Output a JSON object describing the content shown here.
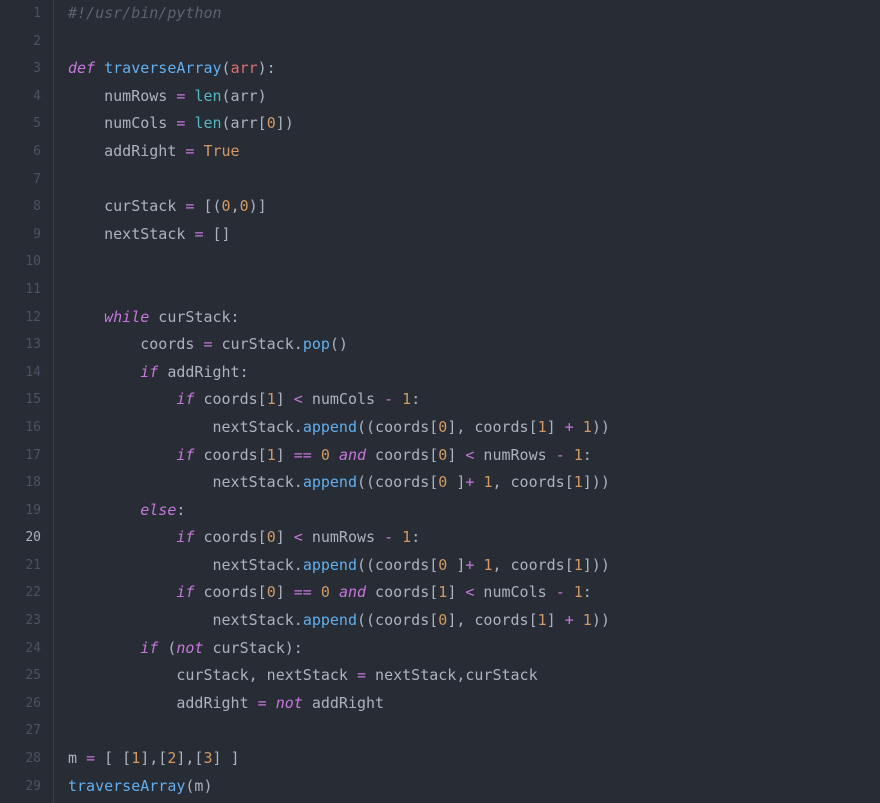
{
  "editor": {
    "active_line": 20,
    "line_numbers": [
      "1",
      "2",
      "3",
      "4",
      "5",
      "6",
      "7",
      "8",
      "9",
      "10",
      "11",
      "12",
      "13",
      "14",
      "15",
      "16",
      "17",
      "18",
      "19",
      "20",
      "21",
      "22",
      "23",
      "24",
      "25",
      "26",
      "27",
      "28",
      "29"
    ],
    "tokens": [
      [
        {
          "t": "#!/usr/bin/python",
          "c": "c-comment"
        }
      ],
      [],
      [
        {
          "t": "def ",
          "c": "c-keyword"
        },
        {
          "t": "traverseArray",
          "c": "c-def"
        },
        {
          "t": "(",
          "c": "c-punct"
        },
        {
          "t": "arr",
          "c": "c-var"
        },
        {
          "t": "):",
          "c": "c-punct"
        }
      ],
      [
        {
          "t": "    numRows ",
          "c": "c-punct"
        },
        {
          "t": "=",
          "c": "c-op"
        },
        {
          "t": " ",
          "c": ""
        },
        {
          "t": "len",
          "c": "c-builtin"
        },
        {
          "t": "(arr)",
          "c": "c-punct"
        }
      ],
      [
        {
          "t": "    numCols ",
          "c": "c-punct"
        },
        {
          "t": "=",
          "c": "c-op"
        },
        {
          "t": " ",
          "c": ""
        },
        {
          "t": "len",
          "c": "c-builtin"
        },
        {
          "t": "(arr[",
          "c": "c-punct"
        },
        {
          "t": "0",
          "c": "c-number"
        },
        {
          "t": "])",
          "c": "c-punct"
        }
      ],
      [
        {
          "t": "    addRight ",
          "c": "c-punct"
        },
        {
          "t": "=",
          "c": "c-op"
        },
        {
          "t": " ",
          "c": ""
        },
        {
          "t": "True",
          "c": "c-const"
        }
      ],
      [],
      [
        {
          "t": "    curStack ",
          "c": "c-punct"
        },
        {
          "t": "=",
          "c": "c-op"
        },
        {
          "t": " [(",
          "c": "c-punct"
        },
        {
          "t": "0",
          "c": "c-number"
        },
        {
          "t": ",",
          "c": "c-punct"
        },
        {
          "t": "0",
          "c": "c-number"
        },
        {
          "t": ")]",
          "c": "c-punct"
        }
      ],
      [
        {
          "t": "    nextStack ",
          "c": "c-punct"
        },
        {
          "t": "=",
          "c": "c-op"
        },
        {
          "t": " []",
          "c": "c-punct"
        }
      ],
      [],
      [],
      [
        {
          "t": "    ",
          "c": ""
        },
        {
          "t": "while",
          "c": "c-keyword"
        },
        {
          "t": " curStack:",
          "c": "c-punct"
        }
      ],
      [
        {
          "t": "        coords ",
          "c": "c-punct"
        },
        {
          "t": "=",
          "c": "c-op"
        },
        {
          "t": " curStack.",
          "c": "c-punct"
        },
        {
          "t": "pop",
          "c": "c-def"
        },
        {
          "t": "()",
          "c": "c-punct"
        }
      ],
      [
        {
          "t": "        ",
          "c": ""
        },
        {
          "t": "if",
          "c": "c-keyword"
        },
        {
          "t": " addRight:",
          "c": "c-punct"
        }
      ],
      [
        {
          "t": "            ",
          "c": ""
        },
        {
          "t": "if",
          "c": "c-keyword"
        },
        {
          "t": " coords[",
          "c": "c-punct"
        },
        {
          "t": "1",
          "c": "c-number"
        },
        {
          "t": "] ",
          "c": "c-punct"
        },
        {
          "t": "<",
          "c": "c-op"
        },
        {
          "t": " numCols ",
          "c": "c-punct"
        },
        {
          "t": "-",
          "c": "c-op"
        },
        {
          "t": " ",
          "c": ""
        },
        {
          "t": "1",
          "c": "c-number"
        },
        {
          "t": ":",
          "c": "c-punct"
        }
      ],
      [
        {
          "t": "                nextStack.",
          "c": "c-punct"
        },
        {
          "t": "append",
          "c": "c-def"
        },
        {
          "t": "((coords[",
          "c": "c-punct"
        },
        {
          "t": "0",
          "c": "c-number"
        },
        {
          "t": "], coords[",
          "c": "c-punct"
        },
        {
          "t": "1",
          "c": "c-number"
        },
        {
          "t": "] ",
          "c": "c-punct"
        },
        {
          "t": "+",
          "c": "c-op"
        },
        {
          "t": " ",
          "c": ""
        },
        {
          "t": "1",
          "c": "c-number"
        },
        {
          "t": "))",
          "c": "c-punct"
        }
      ],
      [
        {
          "t": "            ",
          "c": ""
        },
        {
          "t": "if",
          "c": "c-keyword"
        },
        {
          "t": " coords[",
          "c": "c-punct"
        },
        {
          "t": "1",
          "c": "c-number"
        },
        {
          "t": "] ",
          "c": "c-punct"
        },
        {
          "t": "==",
          "c": "c-op"
        },
        {
          "t": " ",
          "c": ""
        },
        {
          "t": "0",
          "c": "c-number"
        },
        {
          "t": " ",
          "c": ""
        },
        {
          "t": "and",
          "c": "c-keyword"
        },
        {
          "t": " coords[",
          "c": "c-punct"
        },
        {
          "t": "0",
          "c": "c-number"
        },
        {
          "t": "] ",
          "c": "c-punct"
        },
        {
          "t": "<",
          "c": "c-op"
        },
        {
          "t": " numRows ",
          "c": "c-punct"
        },
        {
          "t": "-",
          "c": "c-op"
        },
        {
          "t": " ",
          "c": ""
        },
        {
          "t": "1",
          "c": "c-number"
        },
        {
          "t": ":",
          "c": "c-punct"
        }
      ],
      [
        {
          "t": "                nextStack.",
          "c": "c-punct"
        },
        {
          "t": "append",
          "c": "c-def"
        },
        {
          "t": "((coords[",
          "c": "c-punct"
        },
        {
          "t": "0",
          "c": "c-number"
        },
        {
          "t": " ]",
          "c": "c-punct"
        },
        {
          "t": "+",
          "c": "c-op"
        },
        {
          "t": " ",
          "c": ""
        },
        {
          "t": "1",
          "c": "c-number"
        },
        {
          "t": ", coords[",
          "c": "c-punct"
        },
        {
          "t": "1",
          "c": "c-number"
        },
        {
          "t": "]))",
          "c": "c-punct"
        }
      ],
      [
        {
          "t": "        ",
          "c": ""
        },
        {
          "t": "else",
          "c": "c-keyword"
        },
        {
          "t": ":",
          "c": "c-punct"
        }
      ],
      [
        {
          "t": "            ",
          "c": ""
        },
        {
          "t": "if",
          "c": "c-keyword"
        },
        {
          "t": " coords[",
          "c": "c-punct"
        },
        {
          "t": "0",
          "c": "c-number"
        },
        {
          "t": "] ",
          "c": "c-punct"
        },
        {
          "t": "<",
          "c": "c-op"
        },
        {
          "t": " numRows ",
          "c": "c-punct"
        },
        {
          "t": "-",
          "c": "c-op"
        },
        {
          "t": " ",
          "c": ""
        },
        {
          "t": "1",
          "c": "c-number"
        },
        {
          "t": ":",
          "c": "c-punct"
        }
      ],
      [
        {
          "t": "                nextStack.",
          "c": "c-punct"
        },
        {
          "t": "append",
          "c": "c-def"
        },
        {
          "t": "((coords[",
          "c": "c-punct"
        },
        {
          "t": "0",
          "c": "c-number"
        },
        {
          "t": " ]",
          "c": "c-punct"
        },
        {
          "t": "+",
          "c": "c-op"
        },
        {
          "t": " ",
          "c": ""
        },
        {
          "t": "1",
          "c": "c-number"
        },
        {
          "t": ", coords[",
          "c": "c-punct"
        },
        {
          "t": "1",
          "c": "c-number"
        },
        {
          "t": "]))",
          "c": "c-punct"
        }
      ],
      [
        {
          "t": "            ",
          "c": ""
        },
        {
          "t": "if",
          "c": "c-keyword"
        },
        {
          "t": " coords[",
          "c": "c-punct"
        },
        {
          "t": "0",
          "c": "c-number"
        },
        {
          "t": "] ",
          "c": "c-punct"
        },
        {
          "t": "==",
          "c": "c-op"
        },
        {
          "t": " ",
          "c": ""
        },
        {
          "t": "0",
          "c": "c-number"
        },
        {
          "t": " ",
          "c": ""
        },
        {
          "t": "and",
          "c": "c-keyword"
        },
        {
          "t": " coords[",
          "c": "c-punct"
        },
        {
          "t": "1",
          "c": "c-number"
        },
        {
          "t": "] ",
          "c": "c-punct"
        },
        {
          "t": "<",
          "c": "c-op"
        },
        {
          "t": " numCols ",
          "c": "c-punct"
        },
        {
          "t": "-",
          "c": "c-op"
        },
        {
          "t": " ",
          "c": ""
        },
        {
          "t": "1",
          "c": "c-number"
        },
        {
          "t": ":",
          "c": "c-punct"
        }
      ],
      [
        {
          "t": "                nextStack.",
          "c": "c-punct"
        },
        {
          "t": "append",
          "c": "c-def"
        },
        {
          "t": "((coords[",
          "c": "c-punct"
        },
        {
          "t": "0",
          "c": "c-number"
        },
        {
          "t": "], coords[",
          "c": "c-punct"
        },
        {
          "t": "1",
          "c": "c-number"
        },
        {
          "t": "] ",
          "c": "c-punct"
        },
        {
          "t": "+",
          "c": "c-op"
        },
        {
          "t": " ",
          "c": ""
        },
        {
          "t": "1",
          "c": "c-number"
        },
        {
          "t": "))",
          "c": "c-punct"
        }
      ],
      [
        {
          "t": "        ",
          "c": ""
        },
        {
          "t": "if",
          "c": "c-keyword"
        },
        {
          "t": " (",
          "c": "c-punct"
        },
        {
          "t": "not",
          "c": "c-keyword"
        },
        {
          "t": " curStack):",
          "c": "c-punct"
        }
      ],
      [
        {
          "t": "            curStack, nextStack ",
          "c": "c-punct"
        },
        {
          "t": "=",
          "c": "c-op"
        },
        {
          "t": " nextStack,curStack",
          "c": "c-punct"
        }
      ],
      [
        {
          "t": "            addRight ",
          "c": "c-punct"
        },
        {
          "t": "=",
          "c": "c-op"
        },
        {
          "t": " ",
          "c": ""
        },
        {
          "t": "not",
          "c": "c-keyword"
        },
        {
          "t": " addRight",
          "c": "c-punct"
        }
      ],
      [],
      [
        {
          "t": "m ",
          "c": "c-punct"
        },
        {
          "t": "=",
          "c": "c-op"
        },
        {
          "t": " [ [",
          "c": "c-punct"
        },
        {
          "t": "1",
          "c": "c-number"
        },
        {
          "t": "],[",
          "c": "c-punct"
        },
        {
          "t": "2",
          "c": "c-number"
        },
        {
          "t": "],[",
          "c": "c-punct"
        },
        {
          "t": "3",
          "c": "c-number"
        },
        {
          "t": "] ]",
          "c": "c-punct"
        }
      ],
      [
        {
          "t": "traverseArray",
          "c": "c-def"
        },
        {
          "t": "(m)",
          "c": "c-punct"
        }
      ]
    ]
  }
}
